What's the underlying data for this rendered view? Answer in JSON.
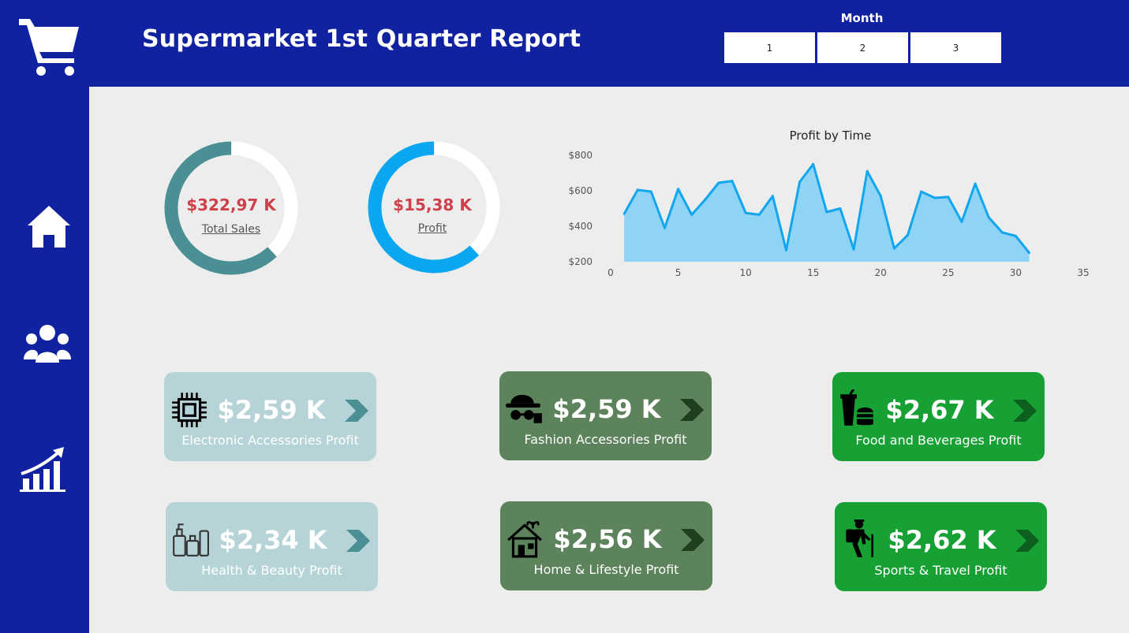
{
  "header": {
    "title": "Supermarket 1st Quarter Report",
    "month_filter": {
      "label": "Month",
      "options": [
        "1",
        "2",
        "3"
      ]
    }
  },
  "sidebar": {
    "items": [
      {
        "icon": "cart-icon"
      },
      {
        "icon": "home-icon"
      },
      {
        "icon": "users-icon"
      },
      {
        "icon": "chart-growth-icon"
      }
    ]
  },
  "kpis": {
    "total_sales": {
      "value": "$322,97 K",
      "label": "Total Sales",
      "fraction": 0.62,
      "color": "#4a8f93"
    },
    "profit": {
      "value": "$15,38 K",
      "label": "Profit",
      "fraction": 0.62,
      "color": "#0aa6f0"
    }
  },
  "cards": [
    {
      "value": "$2,59 K",
      "label": "Electronic Accessories Profit",
      "icon": "chip-icon",
      "bg": "#b6d4d7",
      "arrow_color": "#4a8f93"
    },
    {
      "value": "$2,59 K",
      "label": "Fashion Accessories Profit",
      "icon": "fashion-hat-icon",
      "bg": "#5c835c",
      "arrow_color": "#1f3f1f"
    },
    {
      "value": "$2,67 K",
      "label": "Food and Beverages Profit",
      "icon": "food-drink-icon",
      "bg": "#17a034",
      "arrow_color": "#0d5f1f"
    },
    {
      "value": "$2,34 K",
      "label": "Health & Beauty Profit",
      "icon": "cosmetics-icon",
      "bg": "#b6d4d7",
      "arrow_color": "#4a8f93"
    },
    {
      "value": "$2,56 K",
      "label": "Home & Lifestyle Profit",
      "icon": "house-plant-icon",
      "bg": "#5c835c",
      "arrow_color": "#1f3f1f"
    },
    {
      "value": "$2,62 K",
      "label": "Sports & Travel Profit",
      "icon": "hiker-icon",
      "bg": "#17a034",
      "arrow_color": "#0d5f1f"
    }
  ],
  "chart_data": {
    "type": "area",
    "title": "Profit by Time",
    "xlabel": "",
    "ylabel": "",
    "x_ticks": [
      "0",
      "5",
      "10",
      "15",
      "20",
      "25",
      "30",
      "35"
    ],
    "y_ticks": [
      "$200",
      "$400",
      "$600",
      "$800"
    ],
    "xlim": [
      0,
      35
    ],
    "ylim": [
      200,
      800
    ],
    "x": [
      1,
      2,
      3,
      4,
      5,
      6,
      7,
      8,
      9,
      10,
      11,
      12,
      13,
      14,
      15,
      16,
      17,
      18,
      19,
      20,
      21,
      22,
      23,
      24,
      25,
      26,
      27,
      28,
      29,
      30,
      31
    ],
    "values": [
      470,
      605,
      595,
      390,
      610,
      465,
      550,
      645,
      655,
      475,
      465,
      570,
      265,
      650,
      750,
      480,
      500,
      270,
      710,
      570,
      275,
      350,
      595,
      560,
      565,
      425,
      640,
      450,
      365,
      345,
      250
    ],
    "line_color": "#12a6ee",
    "fill_color": "#8fd3f5",
    "grid": false
  }
}
